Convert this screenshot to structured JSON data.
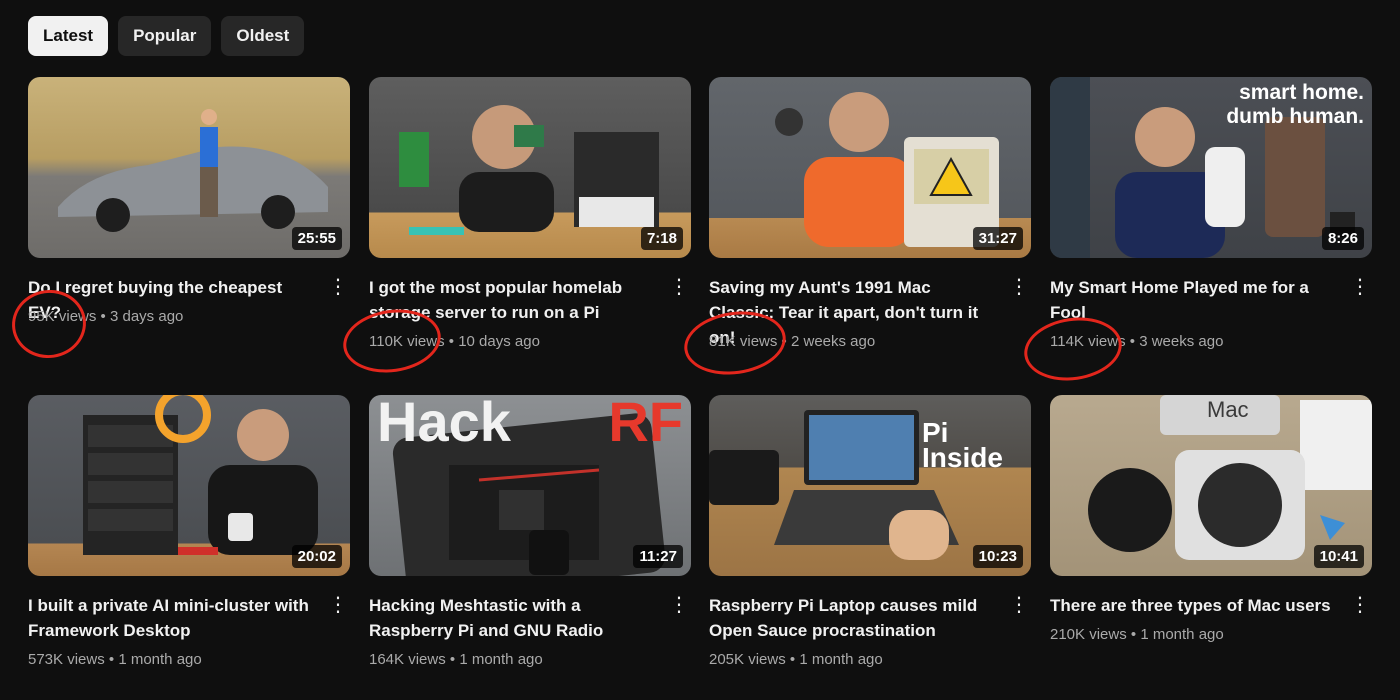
{
  "filters": [
    "Latest",
    "Popular",
    "Oldest"
  ],
  "videos": [
    {
      "title": "Do I regret buying the cheapest EV?",
      "views": "95K views",
      "age": "3 days ago",
      "duration": "25:55"
    },
    {
      "title": "I got the most popular homelab storage server to run on a Pi",
      "views": "110K views",
      "age": "10 days ago",
      "duration": "7:18"
    },
    {
      "title": "Saving my Aunt's 1991 Mac Classic: Tear it apart, don't turn it on!",
      "views": "81K views",
      "age": "2 weeks ago",
      "duration": "31:27"
    },
    {
      "title": "My Smart Home Played me for a Fool",
      "views": "114K views",
      "age": "3 weeks ago",
      "duration": "8:26"
    },
    {
      "title": "I built a private AI mini-cluster with Framework Desktop",
      "views": "573K views",
      "age": "1 month ago",
      "duration": "20:02"
    },
    {
      "title": "Hacking Meshtastic with a Raspberry Pi and GNU Radio",
      "views": "164K views",
      "age": "1 month ago",
      "duration": "11:27"
    },
    {
      "title": "Raspberry Pi Laptop causes mild Open Sauce procrastination",
      "views": "205K views",
      "age": "1 month ago",
      "duration": "10:23"
    },
    {
      "title": "There are three types of Mac users",
      "views": "210K views",
      "age": "1 month ago",
      "duration": "10:41"
    }
  ],
  "separator": "•",
  "menu_glyph": "⋮",
  "thumbnail_text": {
    "smart_home": "smart home.",
    "dumb_human": "dumb human.",
    "hack": "Hack",
    "rf": "RF",
    "pi": "Pi",
    "inside": "Inside",
    "mac": "Mac"
  },
  "colors": {
    "background": "#0f0f0f",
    "chip": "#272727",
    "chip_active": "#f1f1f1",
    "annotation": "#e3261c",
    "meta": "#aaaaaa"
  }
}
